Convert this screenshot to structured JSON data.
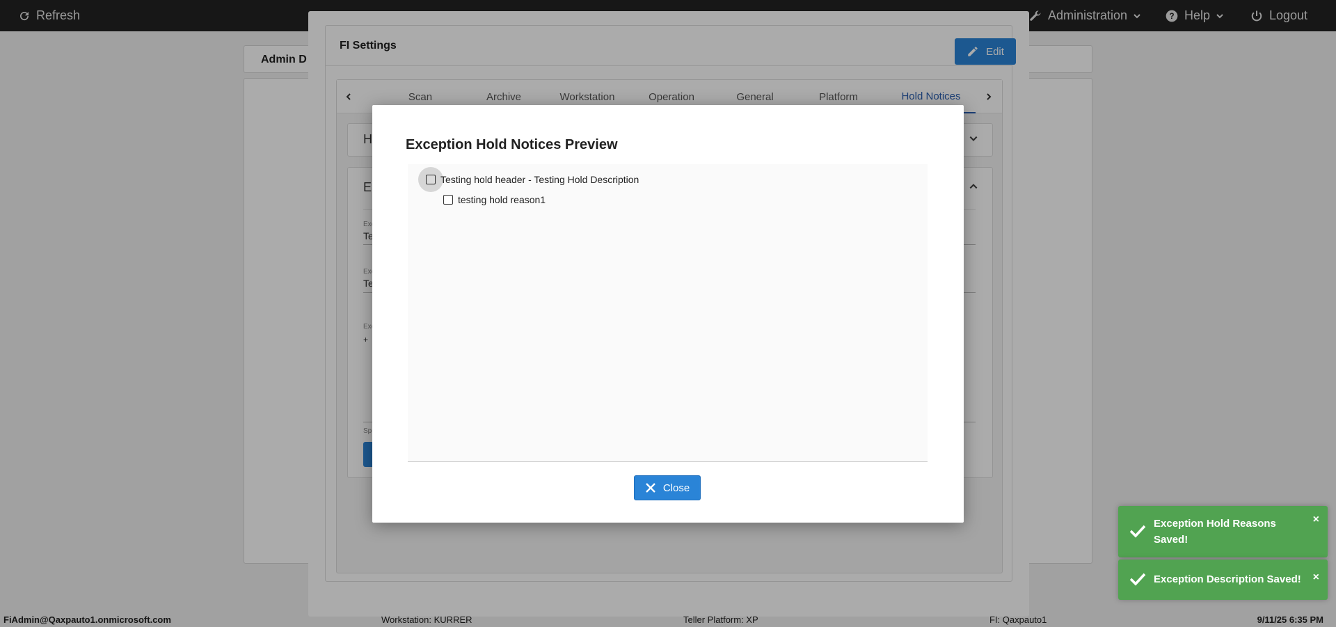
{
  "topbar": {
    "refresh_label": "Refresh",
    "admin_label": "Administration",
    "help_label": "Help",
    "logout_label": "Logout"
  },
  "background": {
    "header_text": "Admin D"
  },
  "settings": {
    "title": "FI Settings",
    "edit_label": "Edit",
    "tabs": [
      "Scan",
      "Archive",
      "Workstation",
      "Operation",
      "General",
      "Platform",
      "Hold Notices"
    ],
    "active_tab": "Hold Notices",
    "section1_letter": "H",
    "section2_letter": "E",
    "field1_label": "Exc",
    "field1_value": "Te",
    "field2_label": "Exc",
    "field2_value": "Te",
    "field3_label": "Exc",
    "field3_value": "+",
    "field4_label": "Sp"
  },
  "preview": {
    "title": "Exception Hold Notices Preview",
    "header_item": "Testing hold header - Testing Hold Description",
    "reason_item": "testing hold reason1",
    "close_label": "Close"
  },
  "toasts": [
    {
      "message": "Exception Hold Reasons Saved!",
      "close": "×"
    },
    {
      "message": "Exception Description Saved!",
      "close": "×"
    }
  ],
  "footer": {
    "user": "FiAdmin@Qaxpauto1.onmicrosoft.com",
    "workstation": "Workstation: KURRER",
    "teller_platform": "Teller Platform: XP",
    "fi": "FI: Qaxpauto1",
    "datetime": "9/11/25 6:35 PM"
  },
  "colors": {
    "topbar": "#232323",
    "accent_blue": "#2a84d7",
    "active_tab": "#2a5fb0",
    "toast_green": "#51a351"
  }
}
